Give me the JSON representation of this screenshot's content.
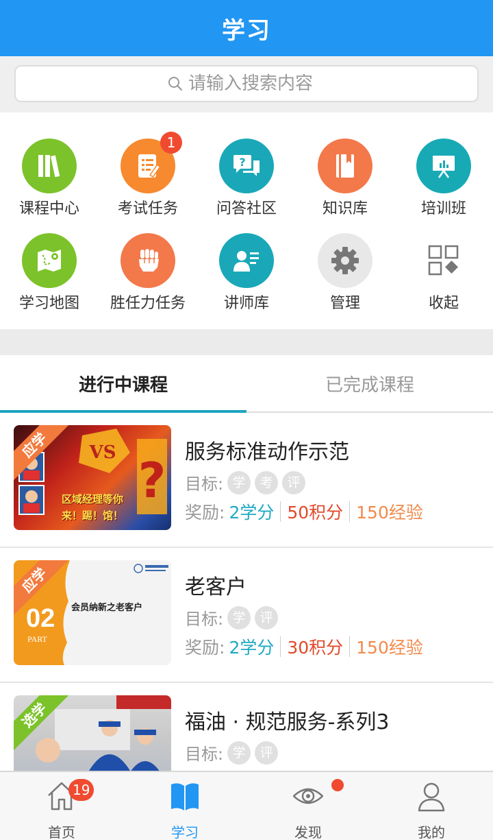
{
  "header": {
    "title": "学习"
  },
  "search": {
    "placeholder": "请输入搜索内容"
  },
  "grid": [
    {
      "label": "课程中心",
      "icon": "books-icon",
      "color": "#7cc22a"
    },
    {
      "label": "考试任务",
      "icon": "exam-checklist-icon",
      "color": "#f7892e",
      "badge": "1"
    },
    {
      "label": "问答社区",
      "icon": "question-chat-icon",
      "color": "#1aa8b8"
    },
    {
      "label": "知识库",
      "icon": "book-icon",
      "color": "#f3784a"
    },
    {
      "label": "培训班",
      "icon": "presentation-board-icon",
      "color": "#17aab5"
    },
    {
      "label": "学习地图",
      "icon": "map-icon",
      "color": "#7cc22a"
    },
    {
      "label": "胜任力任务",
      "icon": "fist-icon",
      "color": "#f3784a"
    },
    {
      "label": "讲师库",
      "icon": "lecturer-icon",
      "color": "#1aa8b8"
    },
    {
      "label": "管理",
      "icon": "gear-icon",
      "color": "#e8e8e8"
    },
    {
      "label": "收起",
      "icon": "collapse-grid-icon",
      "color": "#ffffff"
    }
  ],
  "tabs": {
    "active": "进行中课程",
    "inactive": "已完成课程"
  },
  "courses": [
    {
      "title": "服务标准动作示范",
      "ribbon": "应学",
      "ribbon_color": "#f27a3c",
      "thumb_text": "区域经理等你来！踢！馆！",
      "goal_label": "目标:",
      "goals": [
        "学",
        "考",
        "评"
      ],
      "reward_label": "奖励:",
      "credits": "2学分",
      "points": "50积分",
      "exp": "150经验"
    },
    {
      "title": "老客户",
      "ribbon": "应学",
      "ribbon_color": "#f27a3c",
      "thumb_text": "会员纳新之老客户",
      "thumb_num": "02",
      "thumb_part": "PART",
      "goal_label": "目标:",
      "goals": [
        "学",
        "评"
      ],
      "reward_label": "奖励:",
      "credits": "2学分",
      "points": "30积分",
      "exp": "150经验"
    },
    {
      "title": "福油 · 规范服务-系列3",
      "ribbon": "选学",
      "ribbon_color": "#7cc22a",
      "goal_label": "目标:",
      "goals": [
        "学",
        "评"
      ]
    }
  ],
  "bottom_nav": [
    {
      "label": "首页",
      "icon": "home-icon",
      "badge": "19"
    },
    {
      "label": "学习",
      "icon": "open-book-icon",
      "active": true
    },
    {
      "label": "发现",
      "icon": "eye-icon",
      "dot": true
    },
    {
      "label": "我的",
      "icon": "user-icon"
    }
  ],
  "colors": {
    "brand": "#2196f3",
    "tab_indicator": "#1ea5c0"
  }
}
